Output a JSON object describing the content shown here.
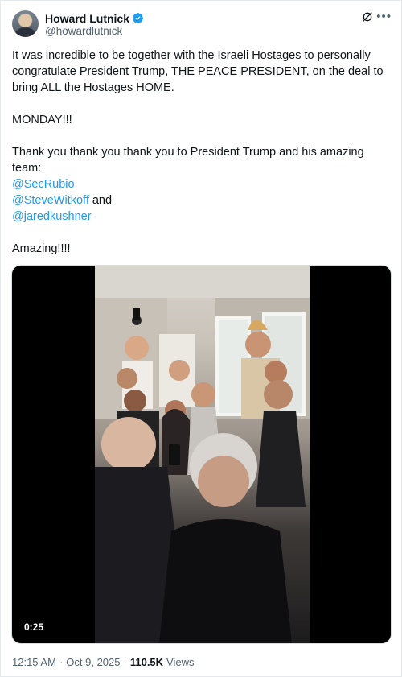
{
  "author": {
    "display_name": "Howard Lutnick",
    "handle": "@howardlutnick",
    "verified_badge_color": "#1d9bf0"
  },
  "icons": {
    "verified": "verified-badge-icon",
    "grok": "grok-icon",
    "more": "more-options-icon"
  },
  "post": {
    "line1": "It was incredible to be together with the Israeli Hostages to personally congratulate President Trump, THE PEACE PRESIDENT, on the deal to bring ALL the Hostages HOME.",
    "line2": "MONDAY!!!",
    "line3": "Thank you thank you thank you to President Trump and his amazing team:",
    "mention1": "@SecRubio",
    "mention2": "@SteveWitkoff",
    "and_text": " and",
    "mention3": "@jaredkushner",
    "line4": "Amazing!!!!"
  },
  "video": {
    "duration": "0:25"
  },
  "meta": {
    "time": "12:15 AM",
    "separator": "·",
    "date": "Oct 9, 2025",
    "views_count": "110.5K",
    "views_label": "Views"
  },
  "colors": {
    "link": "#1d9bf0",
    "secondary_text": "#536471",
    "primary_text": "#0f1419"
  }
}
